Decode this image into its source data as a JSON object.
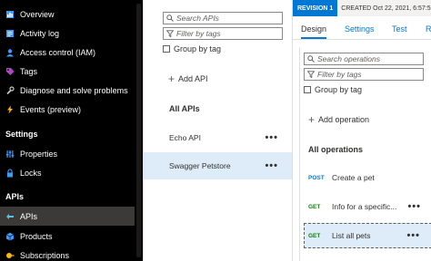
{
  "nav": {
    "items_top": [
      {
        "label": "Overview",
        "icon": "overview-icon",
        "color": "#3b9cff"
      },
      {
        "label": "Activity log",
        "icon": "activity-log-icon",
        "color": "#3b9cff"
      },
      {
        "label": "Access control (IAM)",
        "icon": "iam-icon",
        "color": "#3b9cff"
      },
      {
        "label": "Tags",
        "icon": "tag-icon",
        "color": "#b146c2"
      },
      {
        "label": "Diagnose and solve problems",
        "icon": "wrench-icon",
        "color": "#c8c6c4"
      },
      {
        "label": "Events (preview)",
        "icon": "lightning-icon",
        "color": "#ffb900"
      }
    ],
    "settings_heading": "Settings",
    "items_settings": [
      {
        "label": "Properties",
        "icon": "properties-icon",
        "color": "#3b9cff"
      },
      {
        "label": "Locks",
        "icon": "lock-icon",
        "color": "#3b9cff"
      }
    ],
    "apis_heading": "APIs",
    "items_apis": [
      {
        "label": "APIs",
        "icon": "api-icon",
        "color": "#5ec0e8"
      },
      {
        "label": "Products",
        "icon": "products-icon",
        "color": "#3b9cff"
      },
      {
        "label": "Subscriptions",
        "icon": "subscriptions-icon",
        "color": "#ffb900"
      }
    ]
  },
  "apis_panel": {
    "search_placeholder": "Search APIs",
    "filter_placeholder": "Filter by tags",
    "group_by_tag": "Group by tag",
    "add_api": "Add API",
    "all_apis_heading": "All APIs",
    "items": [
      {
        "name": "Echo API",
        "more": "•••"
      },
      {
        "name": "Swagger Petstore",
        "more": "•••"
      }
    ]
  },
  "detail": {
    "revision_badge": "REVISION 1",
    "created": "CREATED Oct 22, 2021, 6:57:5",
    "tabs": [
      "Design",
      "Settings",
      "Test",
      "Re"
    ],
    "search_placeholder": "Search operations",
    "filter_placeholder": "Filter by tags",
    "group_by_tag": "Group by tag",
    "add_operation": "Add operation",
    "all_ops_heading": "All operations",
    "operations": [
      {
        "verb": "POST",
        "name": "Create a pet",
        "more": ""
      },
      {
        "verb": "GET",
        "name": "Info for a specific...",
        "more": "•••"
      },
      {
        "verb": "GET",
        "name": "List all pets",
        "more": "•••"
      }
    ]
  }
}
